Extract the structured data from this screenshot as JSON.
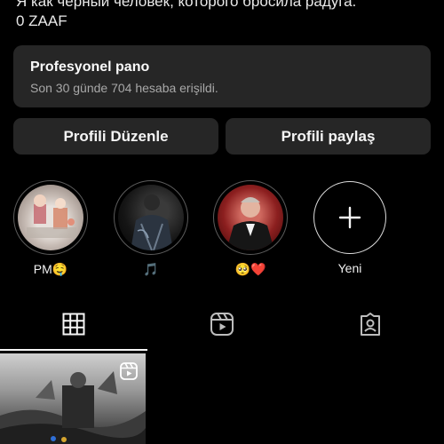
{
  "bio": {
    "line1": "Я как чёрный человек, которого бросила радуга.",
    "link": "0 ZAAF"
  },
  "professional_dashboard": {
    "title": "Profesyonel pano",
    "subtitle": "Son 30 günde 704 hesaba erişildi."
  },
  "actions": {
    "edit_profile": "Profili Düzenle",
    "share_profile": "Profili paylaş"
  },
  "highlights": [
    {
      "label": "PM🤤",
      "image": "collage"
    },
    {
      "label": "🎵",
      "image": "leather-jacket-man"
    },
    {
      "label": "🥺❤️",
      "image": "portrait-red-background"
    }
  ],
  "new_highlight": {
    "label": "Yeni",
    "icon": "plus-icon"
  },
  "tabs": [
    {
      "icon": "grid-icon",
      "selected": true
    },
    {
      "icon": "reels-icon",
      "selected": false
    },
    {
      "icon": "tagged-icon",
      "selected": false
    }
  ],
  "colors": {
    "background": "#000000",
    "panel": "#262626",
    "subtle_text": "#a8a8a8"
  }
}
